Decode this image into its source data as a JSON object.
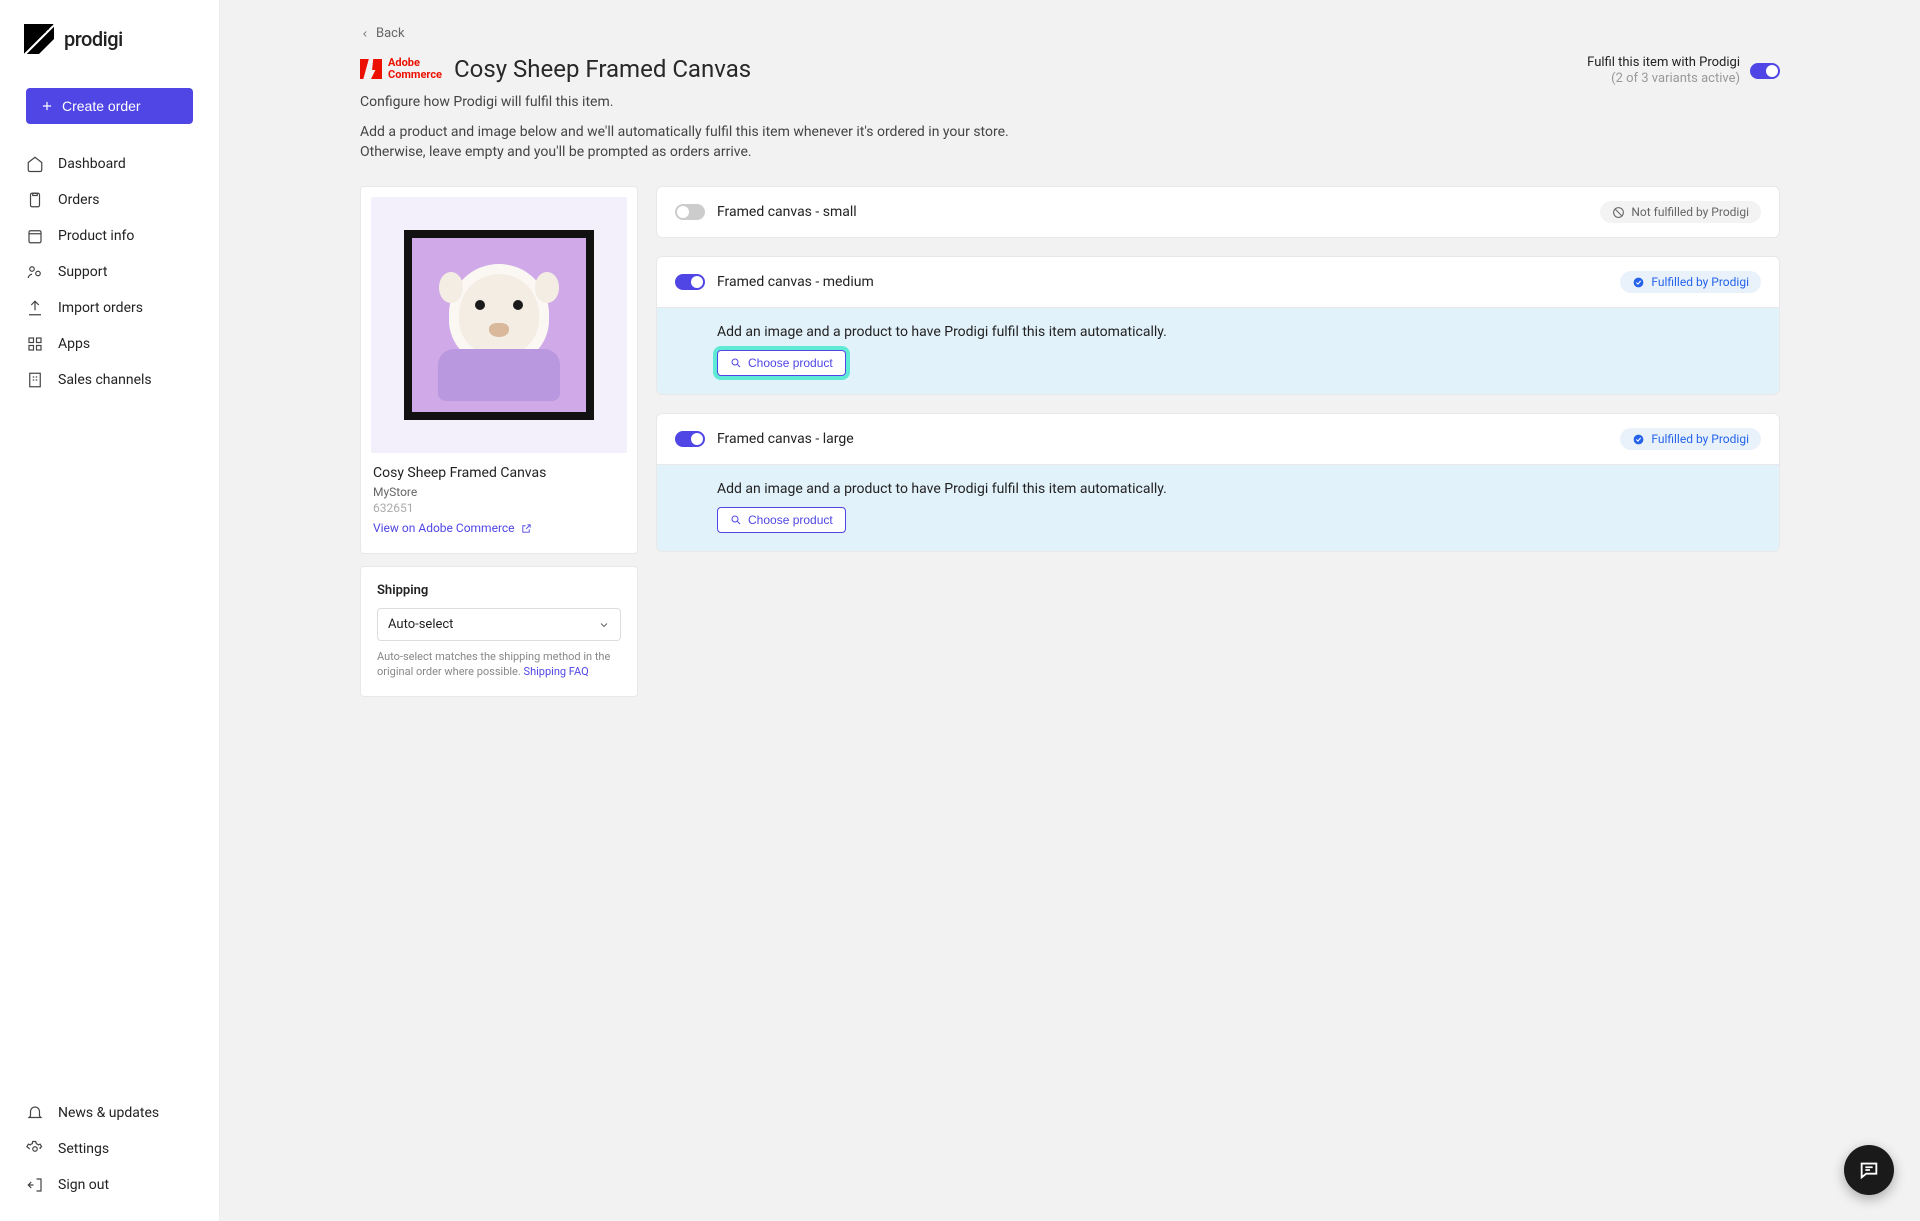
{
  "brand": "prodigi",
  "create_order_label": "Create order",
  "nav": {
    "dashboard": "Dashboard",
    "orders": "Orders",
    "product_info": "Product info",
    "support": "Support",
    "import_orders": "Import orders",
    "apps": "Apps",
    "sales_channels": "Sales channels",
    "news": "News & updates",
    "settings": "Settings",
    "signout": "Sign out"
  },
  "back_label": "Back",
  "platform_label_line1": "Adobe",
  "platform_label_line2": "Commerce",
  "page_title": "Cosy Sheep Framed Canvas",
  "subtitle": "Configure how Prodigi will fulfil this item.",
  "description_line1": "Add a product and image below and we'll automatically fulfil this item whenever it's ordered in your store.",
  "description_line2": "Otherwise, leave empty and you'll be prompted as orders arrive.",
  "fulfil_toggle": {
    "label": "Fulfil this item with Prodigi",
    "subtext": "(2 of 3 variants active)"
  },
  "product": {
    "name": "Cosy Sheep Framed Canvas",
    "store": "MyStore",
    "id": "632651",
    "view_link": "View on Adobe Commerce"
  },
  "shipping": {
    "title": "Shipping",
    "selected": "Auto-select",
    "help_prefix": "Auto-select matches the shipping method in the original order where possible. ",
    "help_link": "Shipping FAQ"
  },
  "variants": [
    {
      "name": "Framed canvas - small",
      "enabled": false,
      "badge": "Not fulfilled by Prodigi"
    },
    {
      "name": "Framed canvas - medium",
      "enabled": true,
      "badge": "Fulfilled by Prodigi",
      "prompt": "Add an image and a product to have Prodigi fulfil this item automatically.",
      "highlighted": true
    },
    {
      "name": "Framed canvas - large",
      "enabled": true,
      "badge": "Fulfilled by Prodigi",
      "prompt": "Add an image and a product to have Prodigi fulfil this item automatically.",
      "highlighted": false
    }
  ],
  "choose_product_label": "Choose product"
}
